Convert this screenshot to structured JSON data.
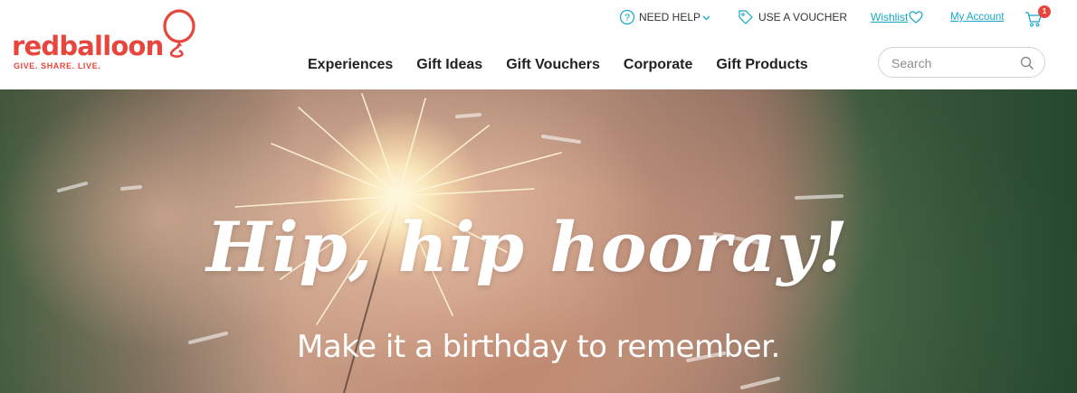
{
  "brand": {
    "name": "redballoon",
    "tagline": "GIVE. SHARE. LIVE.",
    "color": "#e8463d"
  },
  "utility_nav": {
    "help_label": "NEED HELP",
    "voucher_label": "USE A VOUCHER",
    "wishlist_label": "Wishlist",
    "account_label": "My Account",
    "link_color": "#17a7c5",
    "cart_count": "1"
  },
  "main_nav": {
    "items": [
      {
        "label": "Experiences"
      },
      {
        "label": "Gift Ideas"
      },
      {
        "label": "Gift Vouchers"
      },
      {
        "label": "Corporate"
      },
      {
        "label": "Gift Products"
      }
    ]
  },
  "search": {
    "placeholder": "Search",
    "value": ""
  },
  "hero": {
    "title": "Hip, hip hooray!",
    "subtitle": "Make it a birthday to remember."
  },
  "icons": [
    "help-icon",
    "chevron-down-icon",
    "tag-icon",
    "heart-icon",
    "cart-icon",
    "search-icon",
    "balloon-icon"
  ]
}
